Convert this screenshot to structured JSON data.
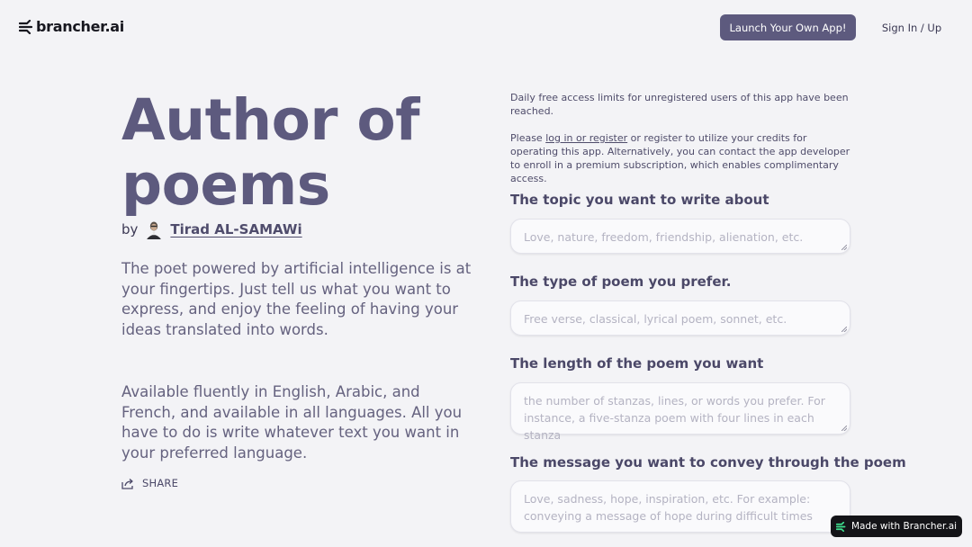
{
  "header": {
    "logo_text": "brancher.ai",
    "launch_button": "Launch Your Own App!",
    "signin": "Sign In / Up"
  },
  "app": {
    "title": "Author of poems",
    "by": "by",
    "author": "Tirad AL-SAMAWi",
    "description1": "The poet powered by artificial intelligence is at your fingertips. Just tell us what you want to express, and enjoy the feeling of having your ideas translated into words.",
    "description2": "Available fluently in English, Arabic, and French, and available in all languages. All you have to do is write whatever text you want in your preferred language.",
    "share": "SHARE"
  },
  "notice": {
    "line1": "Daily free access limits for unregistered users of this app have been reached.",
    "line2_pre": "Please ",
    "line2_link": "log in or register",
    "line2_post": " or register to utilize your credits for operating this app. Alternatively, you can contact the app developer to enroll in a premium subscription, which enables complimentary access."
  },
  "form": {
    "topic_label": "The topic you want to write about",
    "topic_placeholder": "Love, nature, freedom, friendship, alienation, etc.",
    "type_label": "The type of poem you prefer.",
    "type_placeholder": "Free verse, classical, lyrical poem, sonnet, etc.",
    "length_label": "The length of the poem you want",
    "length_placeholder": "the number of stanzas, lines, or words you prefer. For instance, a five-stanza poem with four lines in each stanza",
    "message_label": "The message you want to convey through the poem",
    "message_placeholder": "Love, sadness, hope, inspiration, etc. For example: conveying a message of hope during difficult times"
  },
  "badge": {
    "made_with": "Made with Brancher.ai"
  },
  "colors": {
    "accent": "#5d5a7e",
    "background": "#f3f3f6",
    "badge_bg": "#141418"
  }
}
